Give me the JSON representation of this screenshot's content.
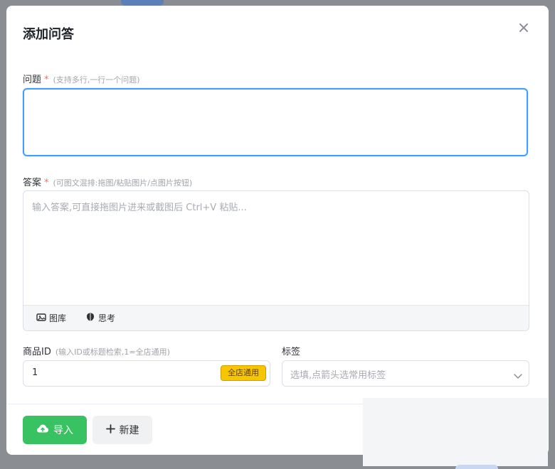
{
  "dialog": {
    "title": "添加问答",
    "close_icon": "close-icon"
  },
  "question": {
    "label": "问题",
    "required_mark": "*",
    "hint": "(支持多行,一行一个问题)",
    "value": ""
  },
  "answer": {
    "label": "答案",
    "required_mark": "*",
    "hint": "(可图文混排:拖图/粘贴图片/点图片按钮)",
    "placeholder": "输入答案,可直接拖图片进来或截图后 Ctrl+V 粘贴...",
    "toolbar": [
      {
        "label": "图库",
        "icon": "image-gallery-icon"
      },
      {
        "label": "思考",
        "icon": "brain-icon"
      }
    ]
  },
  "product": {
    "label": "商品ID",
    "hint": "(输入ID或标题检索,1=全店通用)",
    "value": "1",
    "badge": "全店通用"
  },
  "tags": {
    "label": "标签",
    "placeholder": "选填,点箭头选常用标签"
  },
  "footer": {
    "import_label": "导入",
    "new_label": "新建"
  },
  "colors": {
    "primary_focus": "#409eff",
    "required": "#f56c6c",
    "import_green": "#38c262",
    "badge_yellow": "#f7c600"
  }
}
